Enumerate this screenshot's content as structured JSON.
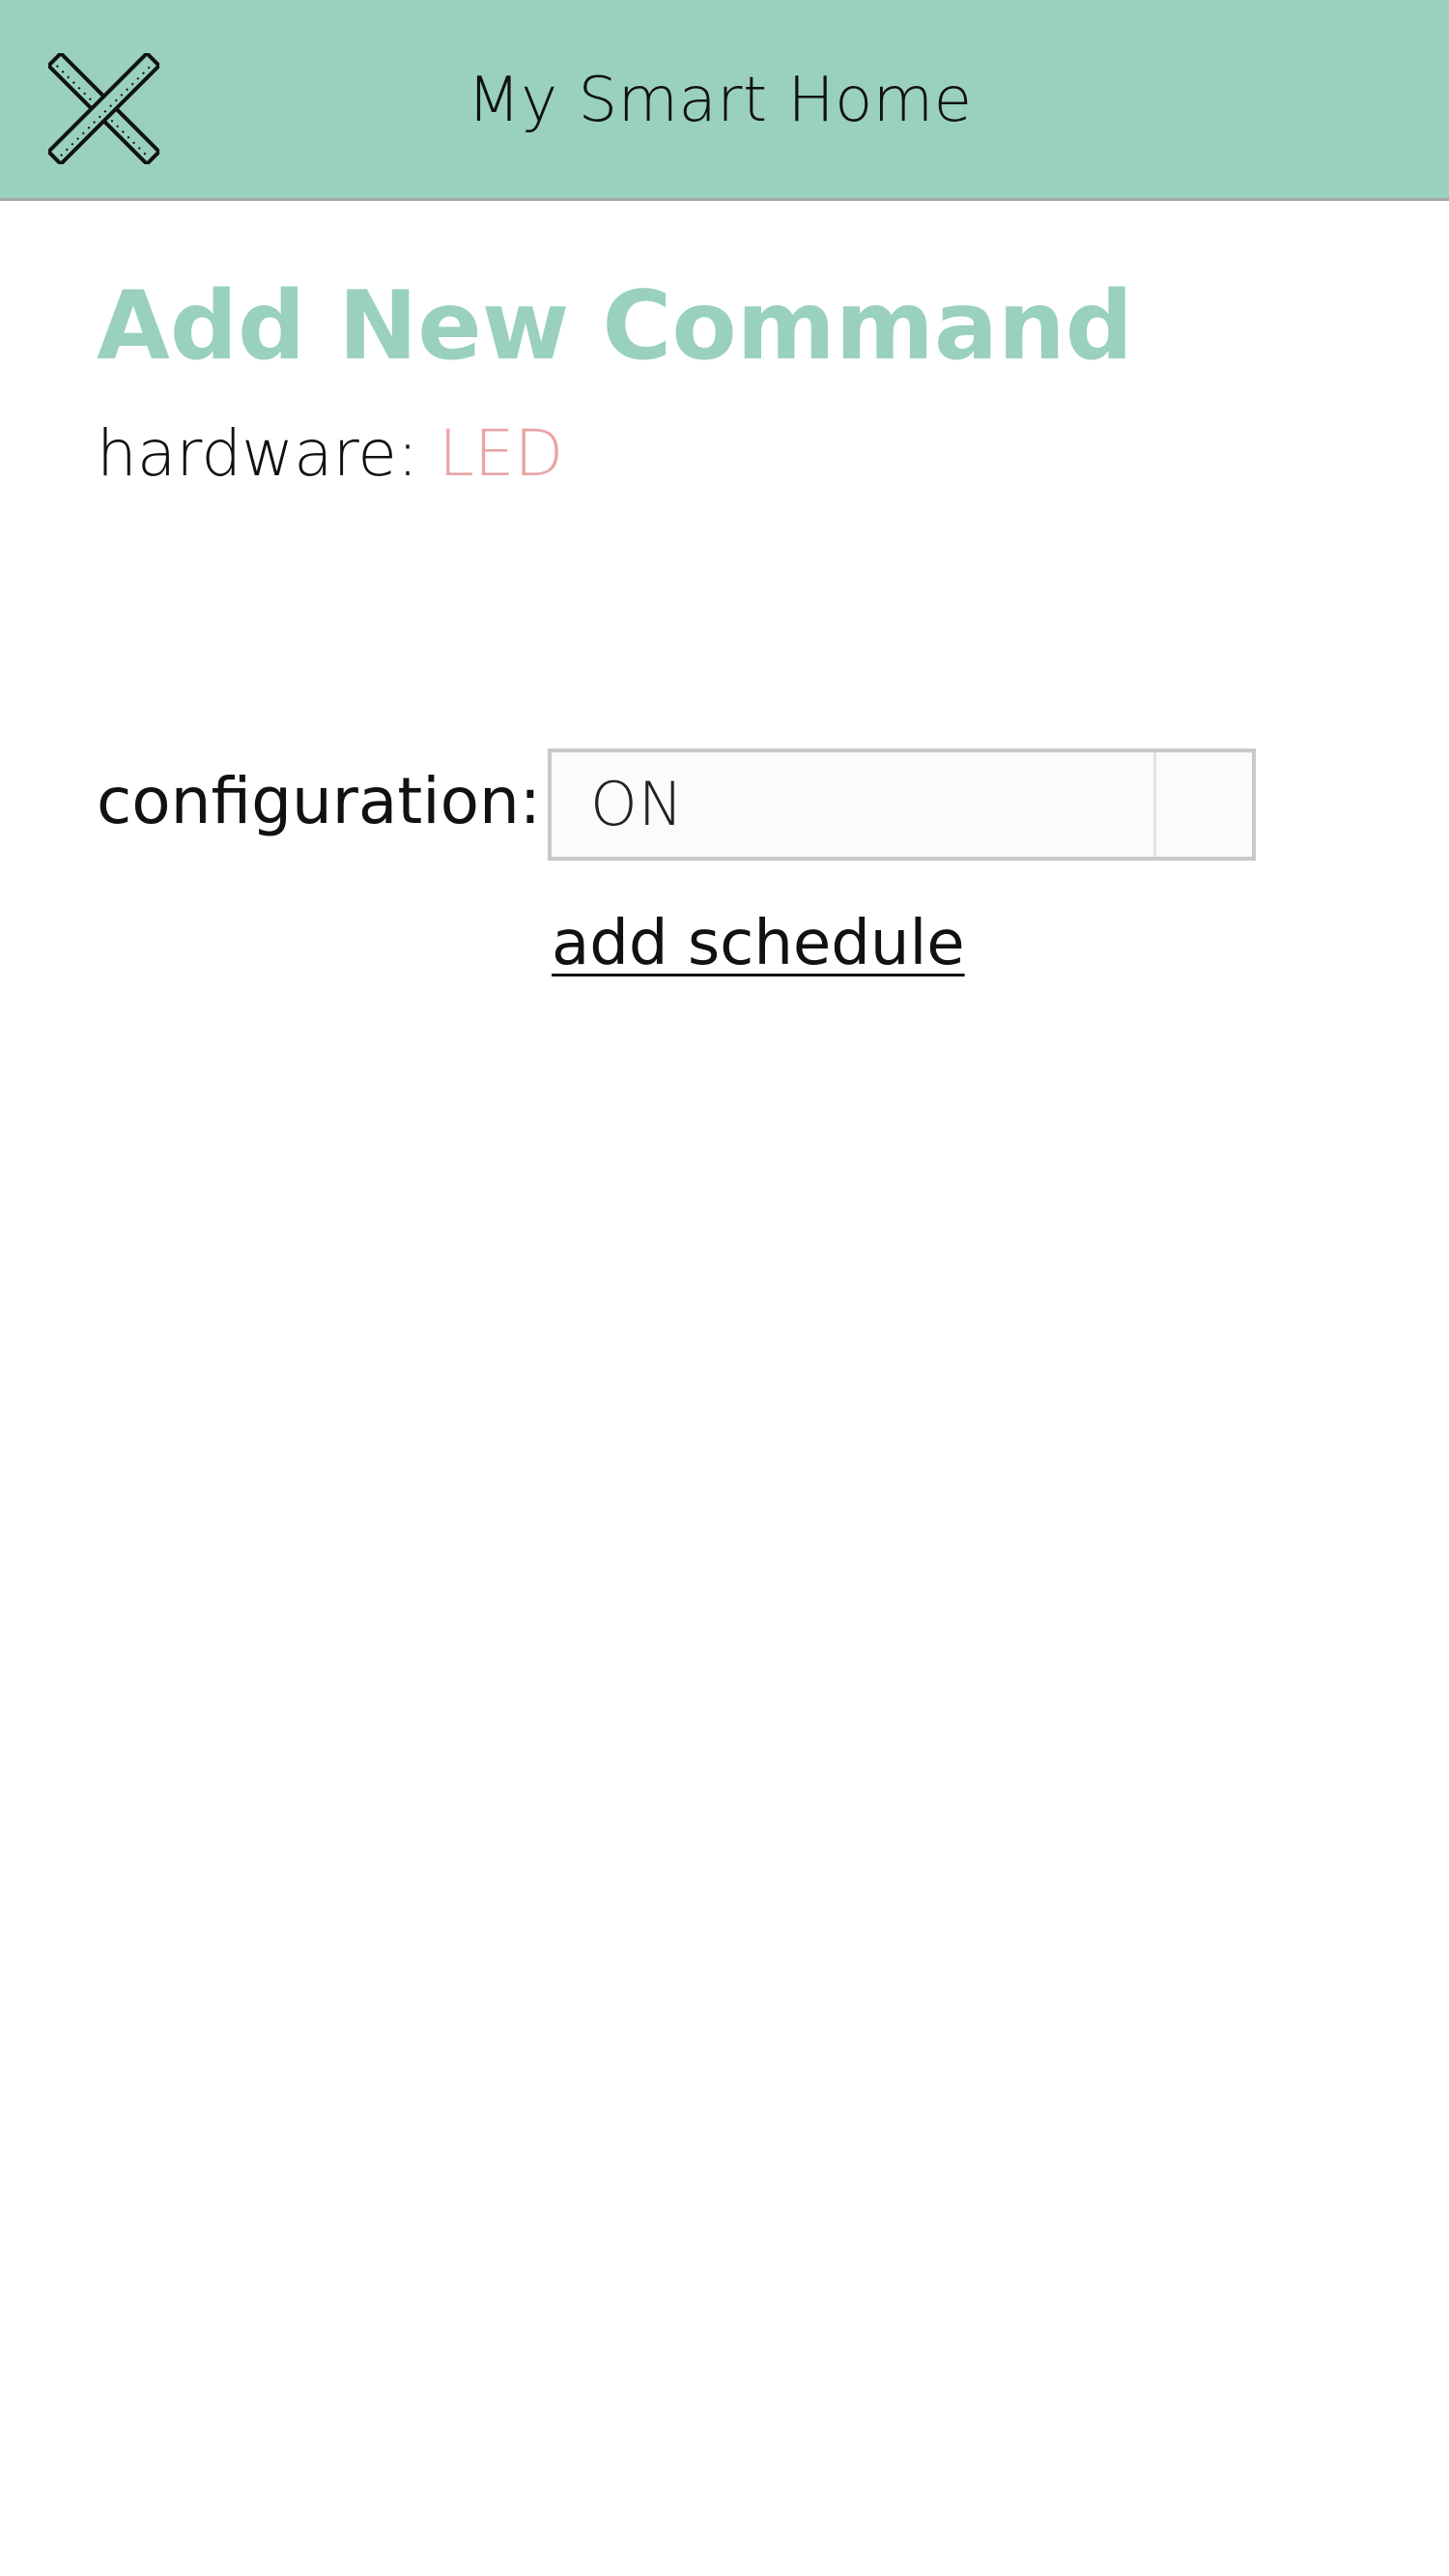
{
  "app_bar": {
    "title": "My Smart Home",
    "close_icon": "close-icon",
    "background": "#99d0bf"
  },
  "form": {
    "title": "Add New Command",
    "title_color": "#99d0bf",
    "hardware_label": "hardware:",
    "hardware_value": "LED",
    "hardware_value_color": "#e8a4a4",
    "configuration_label": "configuration:",
    "configuration_value": "ON",
    "add_schedule_label": "add schedule"
  }
}
